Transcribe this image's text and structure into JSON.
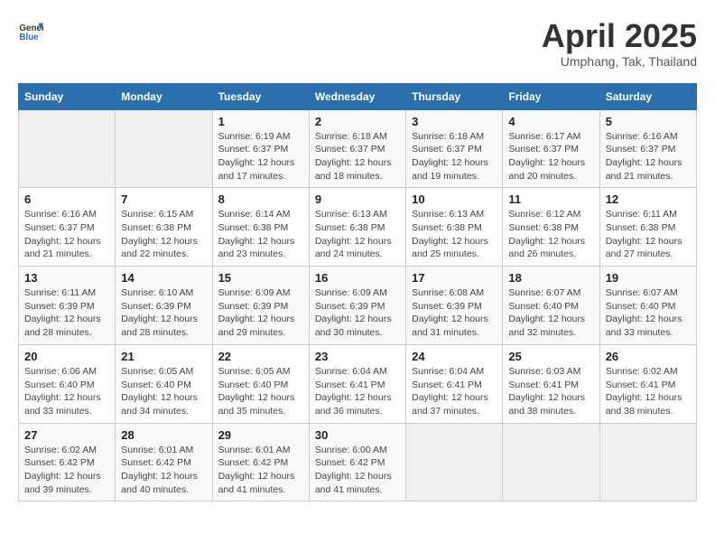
{
  "header": {
    "logo_general": "General",
    "logo_blue": "Blue",
    "title": "April 2025",
    "subtitle": "Umphang, Tak, Thailand"
  },
  "calendar": {
    "weekdays": [
      "Sunday",
      "Monday",
      "Tuesday",
      "Wednesday",
      "Thursday",
      "Friday",
      "Saturday"
    ],
    "weeks": [
      [
        {
          "day": "",
          "empty": true
        },
        {
          "day": "",
          "empty": true
        },
        {
          "day": "1",
          "sunrise": "6:19 AM",
          "sunset": "6:37 PM",
          "daylight": "12 hours and 17 minutes."
        },
        {
          "day": "2",
          "sunrise": "6:18 AM",
          "sunset": "6:37 PM",
          "daylight": "12 hours and 18 minutes."
        },
        {
          "day": "3",
          "sunrise": "6:18 AM",
          "sunset": "6:37 PM",
          "daylight": "12 hours and 19 minutes."
        },
        {
          "day": "4",
          "sunrise": "6:17 AM",
          "sunset": "6:37 PM",
          "daylight": "12 hours and 20 minutes."
        },
        {
          "day": "5",
          "sunrise": "6:16 AM",
          "sunset": "6:37 PM",
          "daylight": "12 hours and 21 minutes."
        }
      ],
      [
        {
          "day": "6",
          "sunrise": "6:16 AM",
          "sunset": "6:37 PM",
          "daylight": "12 hours and 21 minutes."
        },
        {
          "day": "7",
          "sunrise": "6:15 AM",
          "sunset": "6:38 PM",
          "daylight": "12 hours and 22 minutes."
        },
        {
          "day": "8",
          "sunrise": "6:14 AM",
          "sunset": "6:38 PM",
          "daylight": "12 hours and 23 minutes."
        },
        {
          "day": "9",
          "sunrise": "6:13 AM",
          "sunset": "6:38 PM",
          "daylight": "12 hours and 24 minutes."
        },
        {
          "day": "10",
          "sunrise": "6:13 AM",
          "sunset": "6:38 PM",
          "daylight": "12 hours and 25 minutes."
        },
        {
          "day": "11",
          "sunrise": "6:12 AM",
          "sunset": "6:38 PM",
          "daylight": "12 hours and 26 minutes."
        },
        {
          "day": "12",
          "sunrise": "6:11 AM",
          "sunset": "6:38 PM",
          "daylight": "12 hours and 27 minutes."
        }
      ],
      [
        {
          "day": "13",
          "sunrise": "6:11 AM",
          "sunset": "6:39 PM",
          "daylight": "12 hours and 28 minutes."
        },
        {
          "day": "14",
          "sunrise": "6:10 AM",
          "sunset": "6:39 PM",
          "daylight": "12 hours and 28 minutes."
        },
        {
          "day": "15",
          "sunrise": "6:09 AM",
          "sunset": "6:39 PM",
          "daylight": "12 hours and 29 minutes."
        },
        {
          "day": "16",
          "sunrise": "6:09 AM",
          "sunset": "6:39 PM",
          "daylight": "12 hours and 30 minutes."
        },
        {
          "day": "17",
          "sunrise": "6:08 AM",
          "sunset": "6:39 PM",
          "daylight": "12 hours and 31 minutes."
        },
        {
          "day": "18",
          "sunrise": "6:07 AM",
          "sunset": "6:40 PM",
          "daylight": "12 hours and 32 minutes."
        },
        {
          "day": "19",
          "sunrise": "6:07 AM",
          "sunset": "6:40 PM",
          "daylight": "12 hours and 33 minutes."
        }
      ],
      [
        {
          "day": "20",
          "sunrise": "6:06 AM",
          "sunset": "6:40 PM",
          "daylight": "12 hours and 33 minutes."
        },
        {
          "day": "21",
          "sunrise": "6:05 AM",
          "sunset": "6:40 PM",
          "daylight": "12 hours and 34 minutes."
        },
        {
          "day": "22",
          "sunrise": "6:05 AM",
          "sunset": "6:40 PM",
          "daylight": "12 hours and 35 minutes."
        },
        {
          "day": "23",
          "sunrise": "6:04 AM",
          "sunset": "6:41 PM",
          "daylight": "12 hours and 36 minutes."
        },
        {
          "day": "24",
          "sunrise": "6:04 AM",
          "sunset": "6:41 PM",
          "daylight": "12 hours and 37 minutes."
        },
        {
          "day": "25",
          "sunrise": "6:03 AM",
          "sunset": "6:41 PM",
          "daylight": "12 hours and 38 minutes."
        },
        {
          "day": "26",
          "sunrise": "6:02 AM",
          "sunset": "6:41 PM",
          "daylight": "12 hours and 38 minutes."
        }
      ],
      [
        {
          "day": "27",
          "sunrise": "6:02 AM",
          "sunset": "6:42 PM",
          "daylight": "12 hours and 39 minutes."
        },
        {
          "day": "28",
          "sunrise": "6:01 AM",
          "sunset": "6:42 PM",
          "daylight": "12 hours and 40 minutes."
        },
        {
          "day": "29",
          "sunrise": "6:01 AM",
          "sunset": "6:42 PM",
          "daylight": "12 hours and 41 minutes."
        },
        {
          "day": "30",
          "sunrise": "6:00 AM",
          "sunset": "6:42 PM",
          "daylight": "12 hours and 41 minutes."
        },
        {
          "day": "",
          "empty": true
        },
        {
          "day": "",
          "empty": true
        },
        {
          "day": "",
          "empty": true
        }
      ]
    ]
  }
}
